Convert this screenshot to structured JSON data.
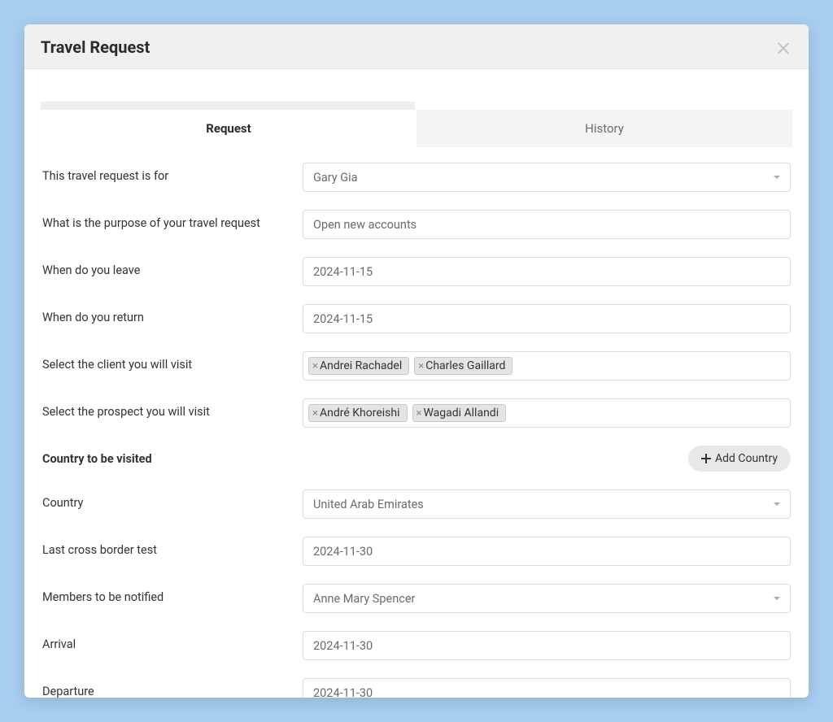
{
  "modal": {
    "title": "Travel Request"
  },
  "tabs": {
    "request": "Request",
    "history": "History"
  },
  "form": {
    "requester": {
      "label": "This travel request is for",
      "value": "Gary Gia"
    },
    "purpose": {
      "label": "What is the purpose of your travel request",
      "value": "Open new accounts"
    },
    "leave": {
      "label": "When do you leave",
      "value": "2024-11-15"
    },
    "return": {
      "label": "When do you return",
      "value": "2024-11-15"
    },
    "clients": {
      "label": "Select the client you will visit",
      "tags": [
        "Andrei Rachadel",
        "Charles Gaillard"
      ]
    },
    "prospects": {
      "label": "Select the prospect you will visit",
      "tags": [
        "André Khoreishi",
        "Wagadi Allandi"
      ]
    },
    "country_section": {
      "heading": "Country to be visited",
      "add_button": "Add Country"
    },
    "country": {
      "label": "Country",
      "value": "United Arab Emirates"
    },
    "last_test": {
      "label": "Last cross border test",
      "value": "2024-11-30"
    },
    "members": {
      "label": "Members to be notified",
      "value": "Anne Mary Spencer"
    },
    "arrival": {
      "label": "Arrival",
      "value": "2024-11-30"
    },
    "departure": {
      "label": "Departure",
      "value": "2024-11-30"
    }
  }
}
